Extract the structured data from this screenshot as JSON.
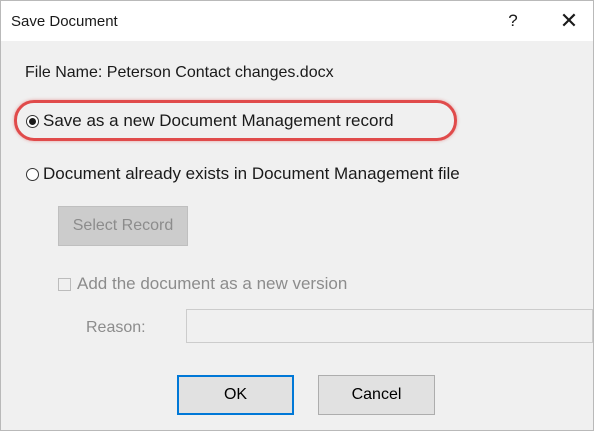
{
  "dialog": {
    "title": "Save Document",
    "help_label": "?",
    "close_label": "✕"
  },
  "file": {
    "label": "File Name: Peterson Contact changes.docx"
  },
  "options": {
    "new_record": {
      "label": "Save as a new Document Management record",
      "selected": true
    },
    "existing": {
      "label": "Document already exists in Document Management file",
      "selected": false
    }
  },
  "select_record": {
    "label": "Select Record",
    "enabled": false
  },
  "new_version": {
    "label": "Add the document as a new version",
    "checked": false,
    "enabled": false
  },
  "reason": {
    "label": "Reason:",
    "value": ""
  },
  "buttons": {
    "ok": "OK",
    "cancel": "Cancel"
  },
  "colors": {
    "highlight": "#e04b4b",
    "focus_border": "#0078d7"
  }
}
